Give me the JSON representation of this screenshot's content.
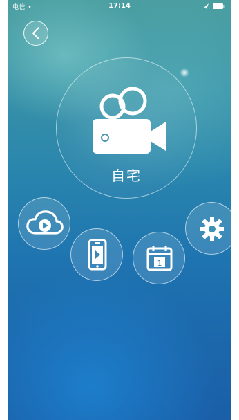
{
  "status_bar": {
    "carrier": "电信 •",
    "time": "17:14"
  },
  "header": {
    "back_icon": "chevron-left-icon"
  },
  "device": {
    "name": "自宅",
    "icon": "video-camera-icon"
  },
  "actions": [
    {
      "name": "cloud-playback",
      "icon": "cloud-play-icon"
    },
    {
      "name": "local-playback",
      "icon": "phone-play-icon"
    },
    {
      "name": "calendar-playback",
      "icon": "calendar-icon",
      "label": "1"
    },
    {
      "name": "settings",
      "icon": "gear-icon"
    }
  ],
  "colors": {
    "background_top": "#4a9ea0",
    "background_bottom": "#1a5fa8",
    "icon_fill": "#ffffff"
  }
}
